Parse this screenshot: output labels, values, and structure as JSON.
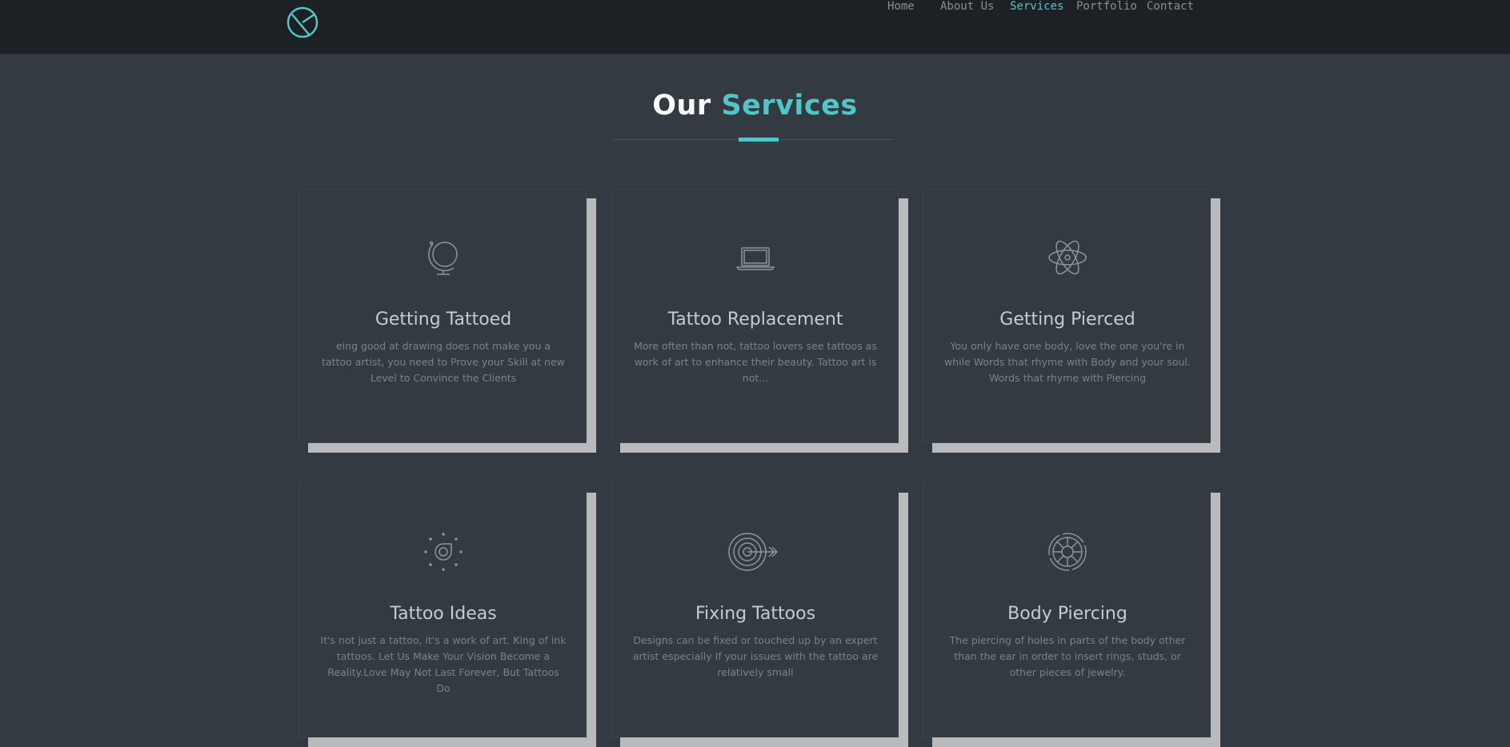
{
  "header": {
    "logo_icon": "compass-circle-icon",
    "nav": [
      {
        "label": "Home",
        "active": false
      },
      {
        "label": "About Us",
        "active": false
      },
      {
        "label": "Services",
        "active": true
      },
      {
        "label": "Portfolio",
        "active": false
      },
      {
        "label": "Contact",
        "active": false
      }
    ]
  },
  "section": {
    "title_main": "Our",
    "title_accent": "Services"
  },
  "services": [
    {
      "icon": "globe-icon",
      "title": "Getting Tattoed",
      "description": "eing good at drawing does not make you a tattoo artist, you need to Prove your Skill at new Level to Convince the Clients"
    },
    {
      "icon": "laptop-icon",
      "title": "Tattoo Replacement",
      "description": "More often than not, tattoo lovers see tattoos as work of art to enhance their beauty. Tattoo art is not..."
    },
    {
      "icon": "atom-icon",
      "title": "Getting Pierced",
      "description": "You only have one body, love the one you're in while Words that rhyme with Body and your soul. Words that rhyme with Piercing"
    },
    {
      "icon": "idea-bulb-icon",
      "title": "Tattoo Ideas",
      "description": "It's not just a tattoo, it's a work of art. King of ink tattoos. Let Us Make Your Vision Become a Reality.Love May Not Last Forever, But Tattoos Do"
    },
    {
      "icon": "target-arrow-icon",
      "title": "Fixing Tattoos",
      "description": "Designs can be fixed or touched up by an expert artist especially If your issues with the tattoo are relatively small"
    },
    {
      "icon": "wheel-icon",
      "title": "Body Piercing",
      "description": "The piercing of holes in parts of the body other than the ear in order to insert rings, studs, or other pieces of jewelry."
    }
  ],
  "colors": {
    "accent": "#4fc6c7",
    "header_bg": "#1d2024",
    "page_bg": "#343a42"
  }
}
